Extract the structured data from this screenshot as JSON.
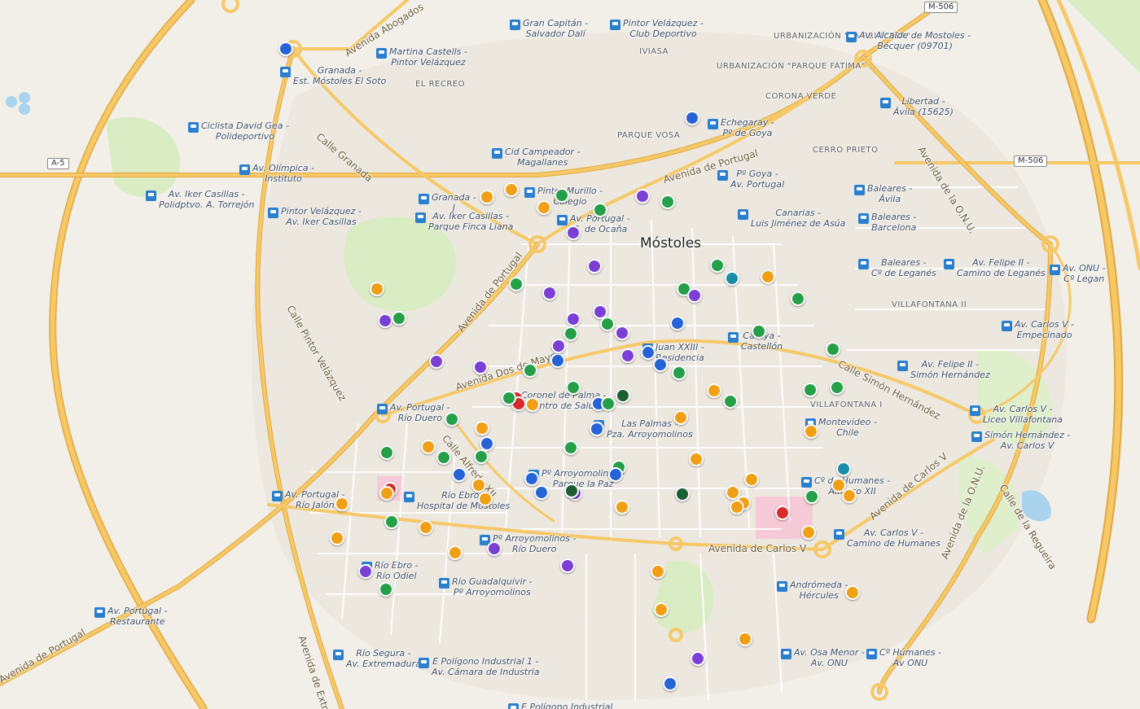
{
  "map": {
    "city_label": "Móstoles",
    "colors": {
      "orange": "#f0a016",
      "green": "#25a049",
      "purple": "#7b3fd6",
      "blue": "#2563d6",
      "red": "#d92b2b",
      "darkgreen": "#1b5e31",
      "teal": "#1a8ea8",
      "road": "#f6c867",
      "road_border": "#e0a93c",
      "park": "#d9ecc4",
      "water": "#a9d3ee"
    },
    "road_labels": [
      "Avenida Abogados",
      "Calle Granada",
      "Avenida de Portugal",
      "Avenida de Portugal",
      "Avenida Dos de Mayo",
      "Calle Pintor Velázquez",
      "Calle Alfredo XII",
      "Avenida de Carlos V",
      "Avenida de Carlos V",
      "Calle Simón Hernández",
      "Avenida de la O.N.U.",
      "Avenida de la O.N.U.",
      "Calle de la Regueira",
      "Avenida de Portugal",
      "Avenida de Extrem"
    ],
    "shields": [
      "A-5",
      "M-506",
      "M-506"
    ],
    "districts": [
      "URBANIZACIÓN \"LA PRINCESA\"",
      "URBANIZACIÓN \"PARQUE FÁTIMA\"",
      "CORONA VERDE",
      "PARQUE VOSA",
      "CERRO PRIETO",
      "IVIASA",
      "EL RECREO",
      "VILLAFONTANA II",
      "VILLAFONTANA I"
    ],
    "stops": [
      "Gran Capitán - Salvador Dalí",
      "Pintor Velázquez - Club Deportivo",
      "Av. Alcalde de Mostoles - Bécquer (09701)",
      "Martina Castells - Pintor Velázquez",
      "Granada - Est. Móstoles El Soto",
      "Ciclista David Gea - Polideportivo",
      "Av. Olímpica - Instituto",
      "Av. Iker Casillas - Polidptvo. A. Torrejón",
      "Pintor Velázquez - Av. Iker Casillas",
      "Granada - J",
      "Av. Iker Casillas - Parque Finca Liana",
      "Cid Campeador - Magallanes",
      "Pintor Murillo - Colegio",
      "Av. Portugal - C. de Ocaña",
      "Echegaray - Pº de Goya",
      "Libertad - Ávila (15625)",
      "Pº Goya - Av. Portugal",
      "Baleares - Ávila",
      "Canarias - Luis Jiménez de Asúa",
      "Baleares - Barcelona",
      "Baleares - Cº de Leganés",
      "Av. Felipe II - Camino de Leganés",
      "Av. ONU - Cº Legan",
      "Av. Carlos V - Empecinado",
      "Cataya - Castellón",
      "Juan XXIII - Residencia",
      "Av. Felipe II - Simón Hernández",
      "Coronel de Palma - Centro de Salud",
      "Av. Portugal - Río Duero",
      "Las Palmas - Pza. Arroyomolinos",
      "Montevideo - Chile",
      "Av. Carlos V - Liceo Villafontana",
      "Simón Hernández - Av. Carlos V",
      "Pº Arroyomolinos - Parque la Paz",
      "Cº de Humanes - Alfonso XII",
      "Av. Portugal - Río Jalón",
      "Río Ebro - Hospital de Móstoles",
      "Pº Arroyomolinos - Río Duero",
      "Av. Carlos V - Camino de Humanes",
      "Río Ebro - Río Odiel",
      "Río Guadalquivir - Pº Arroyomolinos",
      "Andrómeda - Hércules",
      "Av. Portugal - Restaurante",
      "Río Segura - Av. Extremadura",
      "E Polígono Industrial 1 - Av. Cámara de Industria",
      "Av. Osa Menor - Av. ONU",
      "Cº Húmanes - Av ONU",
      "E Polígono Industrial"
    ]
  }
}
